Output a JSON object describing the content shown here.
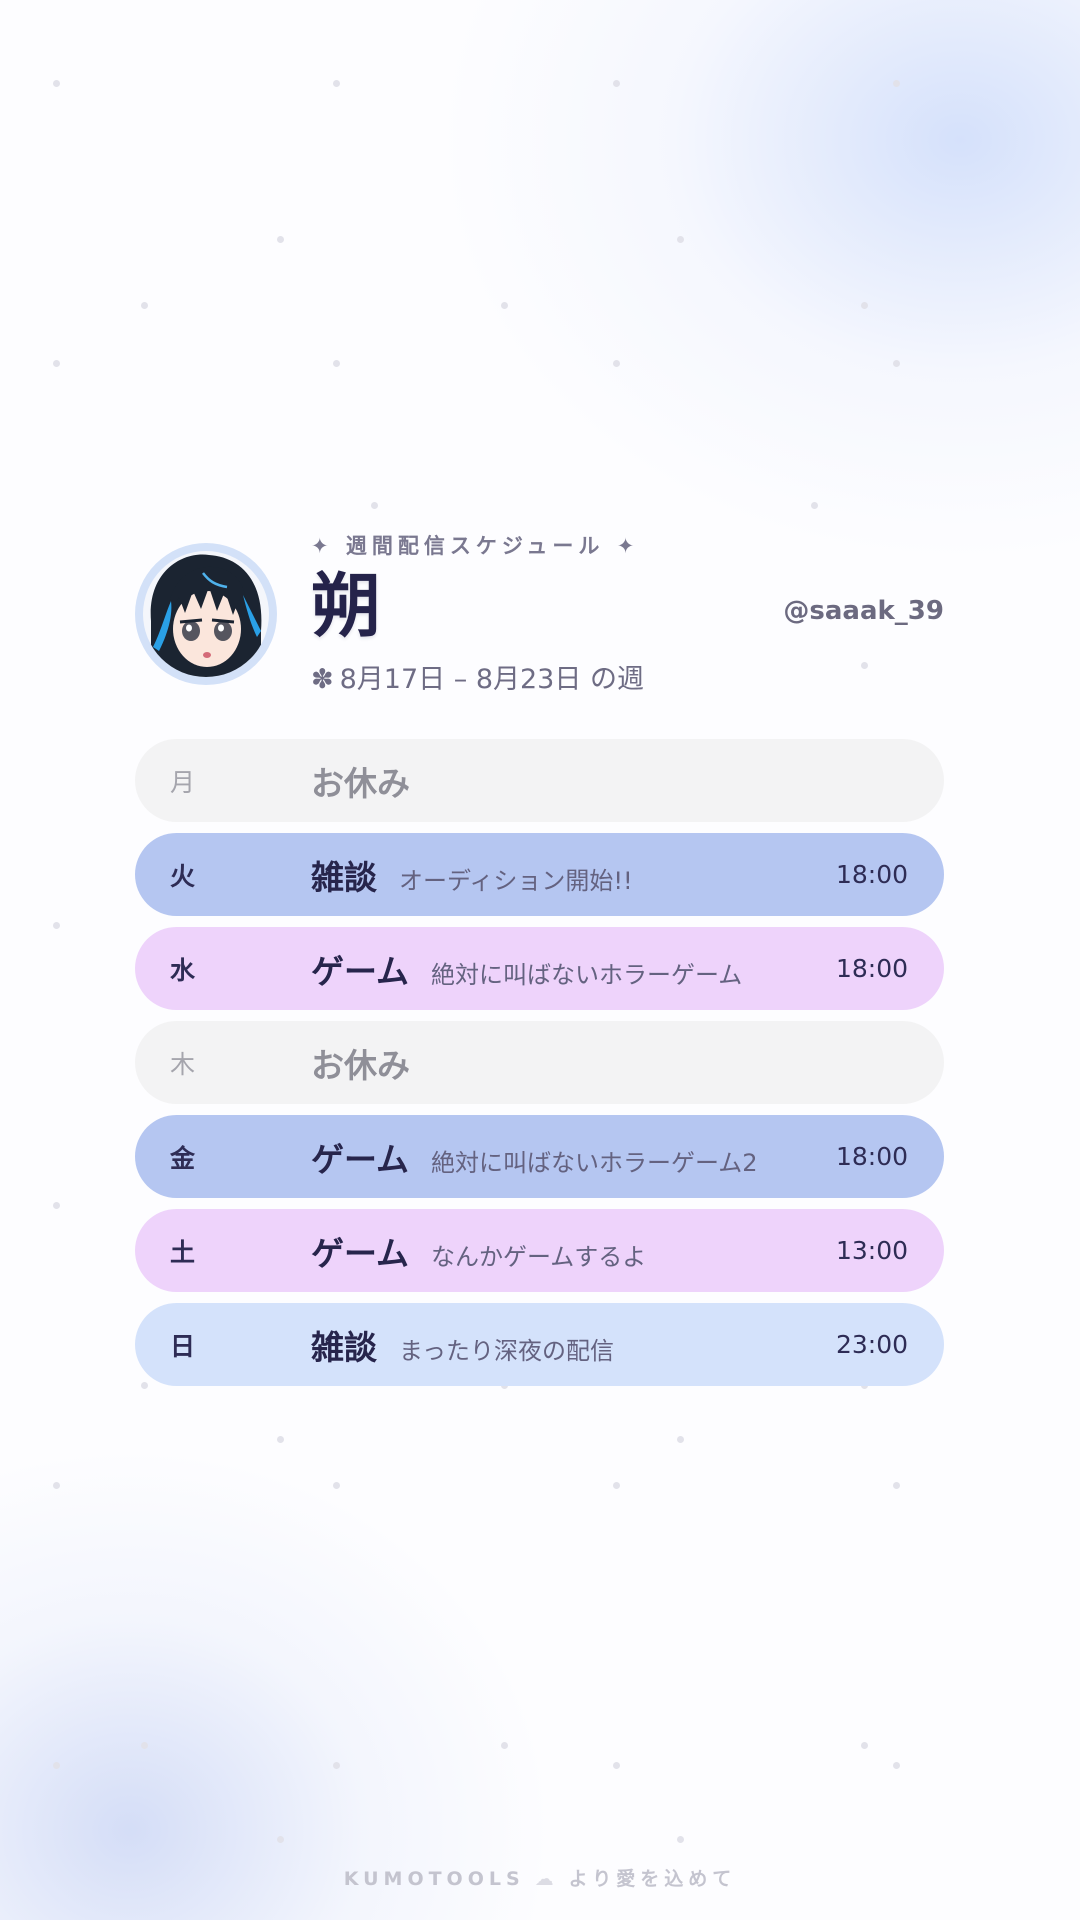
{
  "header": {
    "subtitle": "✦ 週間配信スケジュール ✦",
    "name": "朔",
    "week_icon": "✽",
    "week_range": "8月17日 – 8月23日 の週",
    "handle": "@saaak_39",
    "avatar_icon": "anime-character-avatar"
  },
  "schedule": [
    {
      "day": "月",
      "category": "お休み",
      "description": "",
      "time": "",
      "color": "#f3f3f4"
    },
    {
      "day": "火",
      "category": "雑談",
      "description": "オーディション開始!!",
      "time": "18:00",
      "color": "#b5c6f1"
    },
    {
      "day": "水",
      "category": "ゲーム",
      "description": "絶対に叫ばないホラーゲーム",
      "time": "18:00",
      "color": "#eed3fb"
    },
    {
      "day": "木",
      "category": "お休み",
      "description": "",
      "time": "",
      "color": "#f3f3f4"
    },
    {
      "day": "金",
      "category": "ゲーム",
      "description": "絶対に叫ばないホラーゲーム2",
      "time": "18:00",
      "color": "#b5c6f1"
    },
    {
      "day": "土",
      "category": "ゲーム",
      "description": "なんかゲームするよ",
      "time": "13:00",
      "color": "#eed3fb"
    },
    {
      "day": "日",
      "category": "雑談",
      "description": "まったり深夜の配信",
      "time": "23:00",
      "color": "#d4e2fb"
    }
  ],
  "footer": {
    "brand": "KUMOTOOLS",
    "cloud_icon": "☁",
    "tagline": "より愛を込めて"
  }
}
